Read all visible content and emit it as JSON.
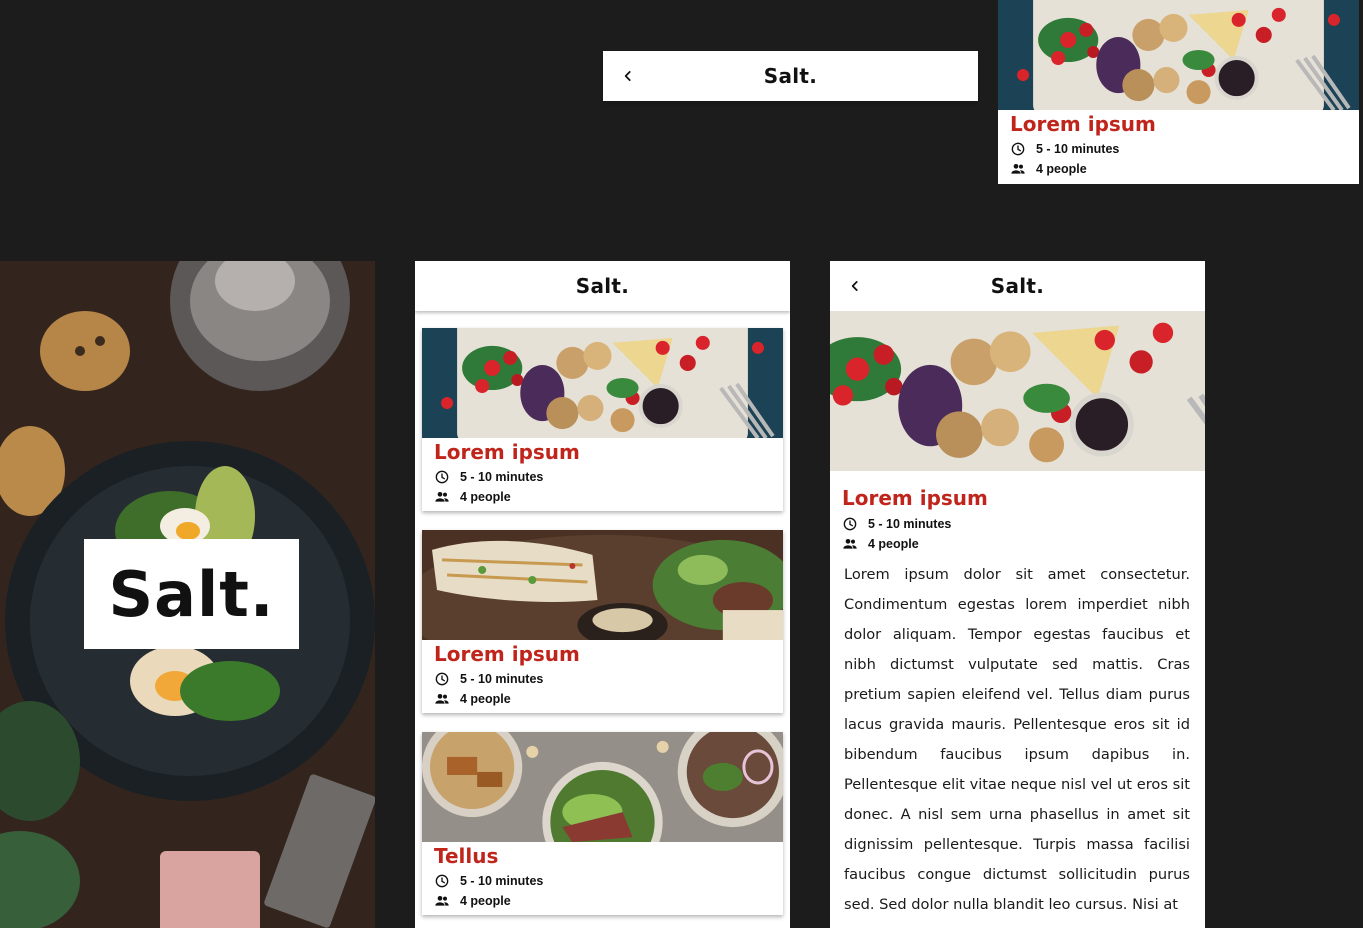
{
  "brand": "Salt.",
  "splash": {
    "logo": "Salt."
  },
  "recipes": [
    {
      "title": "Lorem ipsum",
      "time": "5 - 10 minutes",
      "servings": "4 people",
      "photo": "cheese-board-photo"
    },
    {
      "title": "Lorem ipsum",
      "time": "5 - 10 minutes",
      "servings": "4 people",
      "photo": "grilled-chicken-salad-photo"
    },
    {
      "title": "Tellus",
      "time": "5 - 10 minutes",
      "servings": "4 people",
      "photo": "steak-plates-photo"
    }
  ],
  "component_card": {
    "title": "Lorem ipsum",
    "time": "5 - 10 minutes",
    "servings": "4 people"
  },
  "detail": {
    "title": "Lorem ipsum",
    "time": "5 - 10 minutes",
    "servings": "4 people",
    "body": "Lorem ipsum dolor sit amet consectetur. Condimentum egestas lorem imperdiet nibh dolor aliquam. Tempor egestas faucibus et nibh dictumst vulputate sed mattis. Cras pretium sapien eleifend vel. Tellus diam purus lacus gravida mauris. Pellentesque eros sit id bibendum faucibus ipsum dapibus in. Pellentesque elit vitae neque nisl vel ut eros sit donec. A nisl sem urna phasellus in amet sit dignissim pellentesque. Turpis massa facilisi faucibus congue dictumst sollicitudin purus sed. Sed dolor nulla blandit leo cursus. Nisi at"
  },
  "icons": {
    "back": "chevron-left-icon",
    "time": "clock-icon",
    "servings": "people-icon"
  },
  "colors": {
    "accent": "#c0251c",
    "background": "#1c1c1c",
    "surface": "#ffffff"
  }
}
